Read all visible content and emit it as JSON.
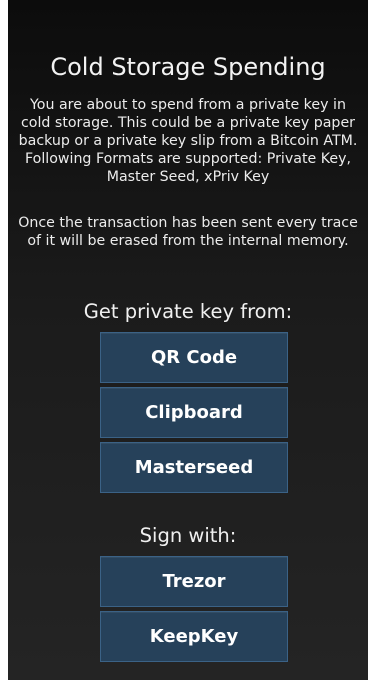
{
  "screen": {
    "title": "Cold Storage Spending",
    "intro": "You are about to spend from a private key in cold storage. This could be a private key paper backup or a private key slip from a Bitcoin ATM. Following Formats are supported: Private Key, Master Seed, xPriv Key",
    "note": "Once the transaction has been sent every trace of it will be erased from the internal memory."
  },
  "source_section": {
    "label": "Get private key from:",
    "buttons": {
      "qr_code": "QR Code",
      "clipboard": "Clipboard",
      "masterseed": "Masterseed"
    }
  },
  "sign_section": {
    "label": "Sign with:",
    "buttons": {
      "trezor": "Trezor",
      "keepkey": "KeepKey"
    }
  },
  "colors": {
    "background": "#1b1b1b",
    "button_fill": "#26415a",
    "button_border": "#3b6286",
    "text": "#ffffff"
  }
}
